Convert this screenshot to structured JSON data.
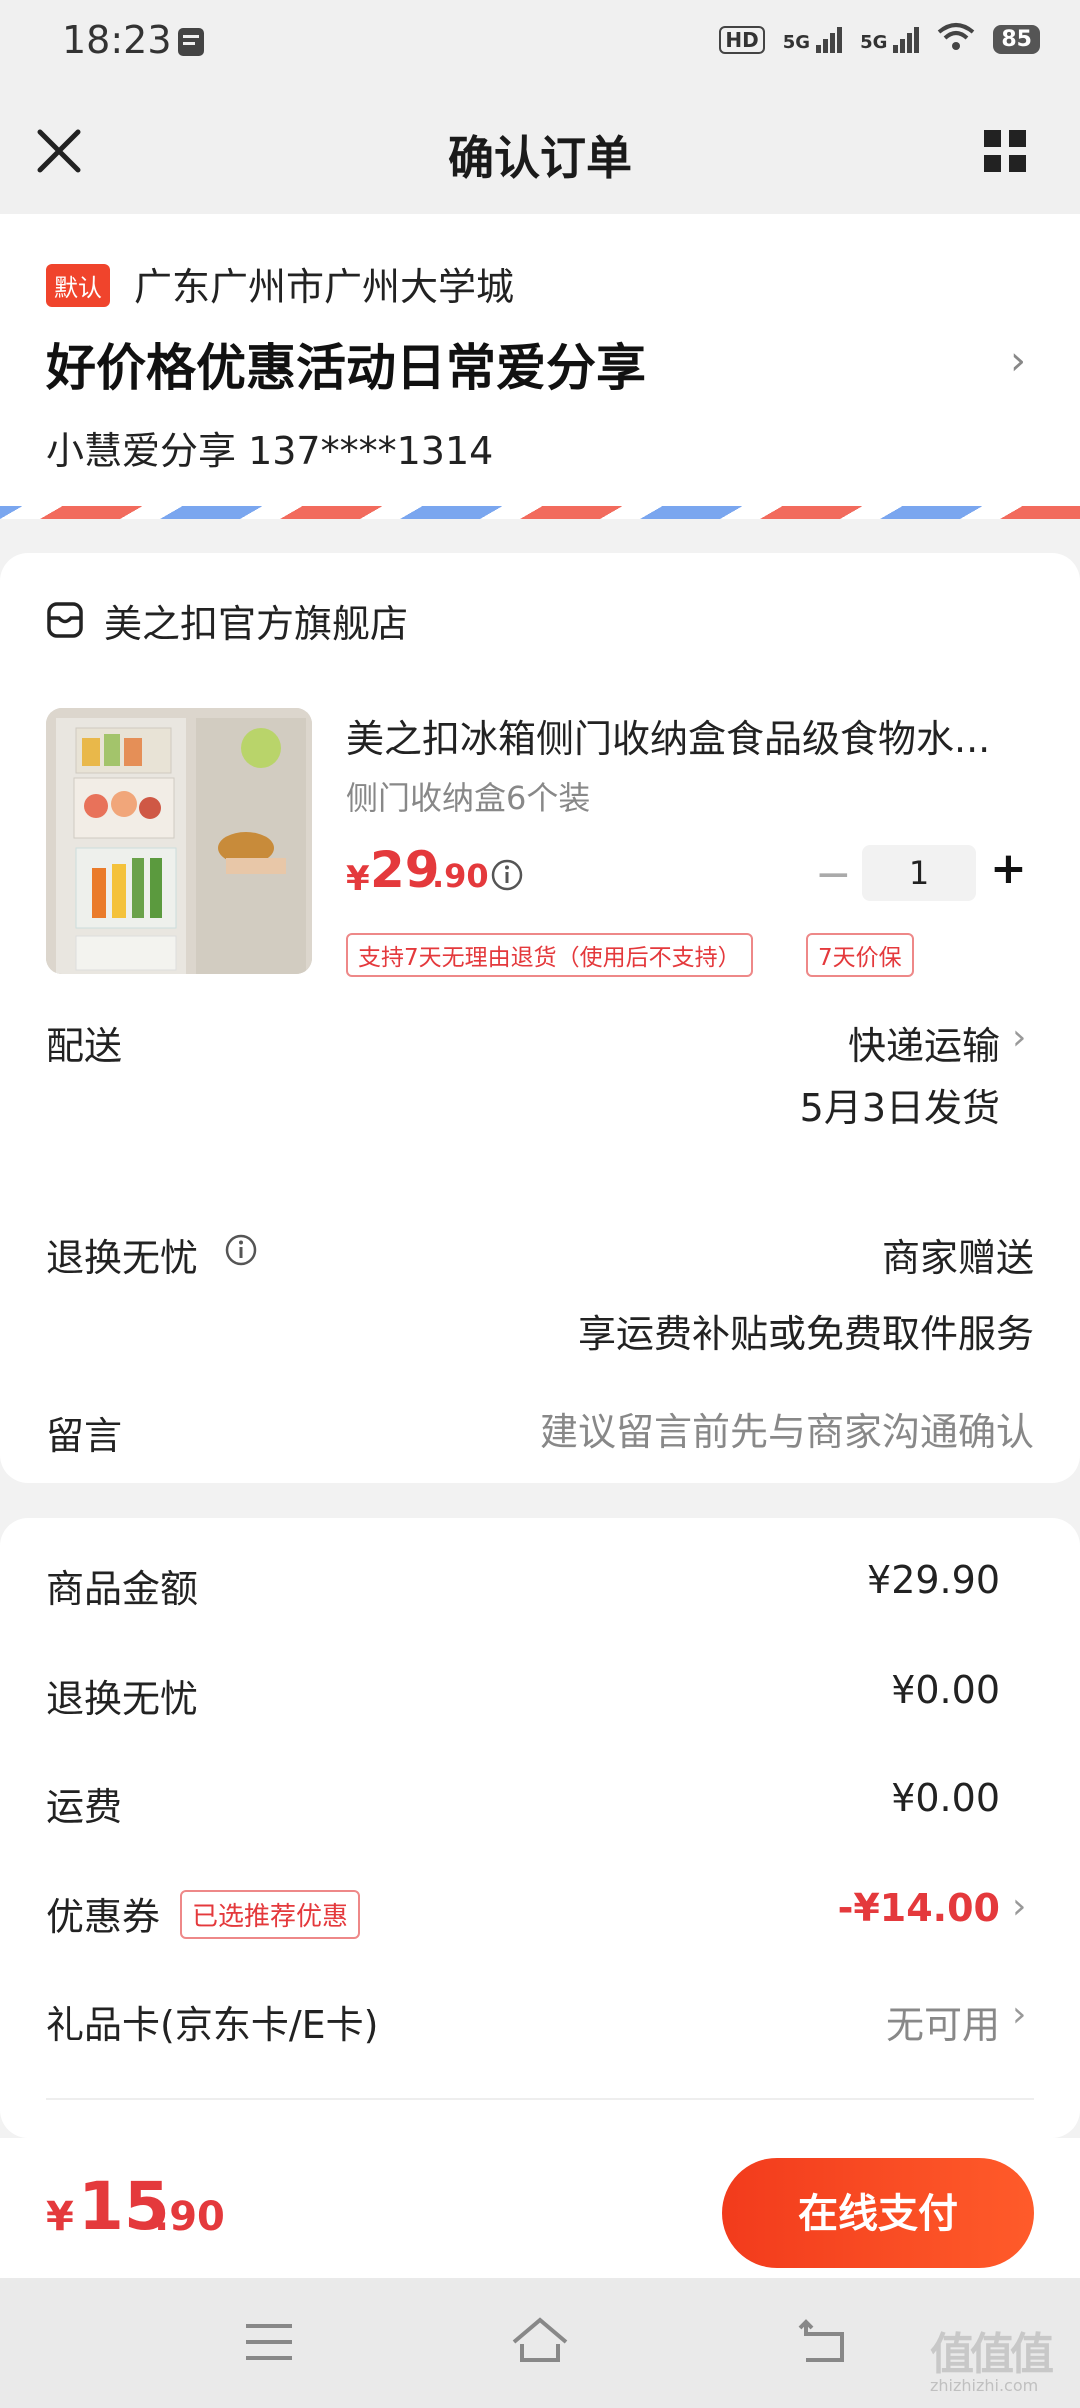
{
  "status_bar": {
    "time": "18:23",
    "network_1": "HD",
    "network_2": "5G",
    "network_3": "5G",
    "battery": "85"
  },
  "header": {
    "title": "确认订单"
  },
  "address": {
    "default_badge": "默认",
    "region": "广东广州市广州大学城",
    "detail": "好价格优惠活动日常爱分享",
    "contact": "小慧爱分享  137****1314"
  },
  "shop": {
    "name": "美之扣官方旗舰店"
  },
  "product": {
    "title": "美之扣冰箱侧门收纳盒食品级食物水...",
    "spec": "侧门收纳盒6个装",
    "price_symbol": "¥",
    "price_int": "29",
    "price_dec": ".90",
    "quantity": "1",
    "minus": "−",
    "plus": "+",
    "tags": [
      "支持7天无理由退货（使用后不支持）",
      "7天价保"
    ]
  },
  "delivery": {
    "label": "配送",
    "method": "快递运输",
    "ship_date": "5月3日发货"
  },
  "return_service": {
    "label": "退换无忧",
    "value": "商家赠送",
    "desc": "享运费补贴或免费取件服务"
  },
  "message": {
    "label": "留言",
    "placeholder": "建议留言前先与商家沟通确认"
  },
  "summary": {
    "goods_label": "商品金额",
    "goods_value": "¥29.90",
    "return_label": "退换无忧",
    "return_value": "¥0.00",
    "shipping_label": "运费",
    "shipping_value": "¥0.00",
    "coupon_label": "优惠券",
    "coupon_tag": "已选推荐优惠",
    "coupon_value": "-¥14.00",
    "giftcard_label": "礼品卡(京东卡/E卡)",
    "giftcard_value": "无可用"
  },
  "pay_bar": {
    "total_symbol": "¥",
    "total_int": "15",
    "total_dec": ".90",
    "pay_label": "在线支付"
  },
  "watermark": {
    "text": "值值值",
    "sub": "zhizhizhi.com"
  },
  "colors": {
    "accent": "#e4393c",
    "pay_button": "#f23b1c",
    "badge": "#f0442c"
  }
}
